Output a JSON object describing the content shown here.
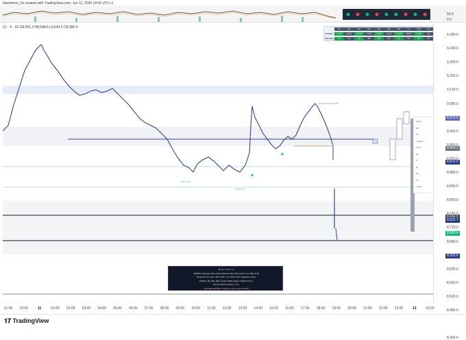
{
  "credit_text": "Nardmirch_0x created with TradingView.com, Jun 11, 2026 18:43 UTC+1",
  "symbol_line": "CL · 5 · IG  O8,551.3  H8,588.5  L8,544.5  C8,580.4",
  "right_axis": {
    "ticks": [
      "9,280.0",
      "9,240.0",
      "9,200.0",
      "9,160.0",
      "9,120.0",
      "9,080.0",
      "9,040.0",
      "9,000.0",
      "8,960.0",
      "8,920.0",
      "8,880.0",
      "8,840.0",
      "8,800.0",
      "8,760.0",
      "8,720.0",
      "8,680.0",
      "8,640.0",
      "8,600.0",
      "8,560.0",
      "8,520.0",
      "8,480.0",
      "8,440.0",
      "8,400.0"
    ],
    "tags": [
      {
        "text": "8,975.9",
        "color": "#5b6abf"
      },
      {
        "text": "8,869.2",
        "color": "#6b7280"
      },
      {
        "text": "8,823.9",
        "color": "#1e3a8a"
      },
      {
        "text": "8,642.5",
        "color": "#374151"
      },
      {
        "text": "8,622.7",
        "color": "#1e3a8a"
      },
      {
        "text": "8,580.4",
        "color": "#10b981"
      },
      {
        "text": "8,503.6",
        "color": "#1e3a8a"
      }
    ]
  },
  "indicator_axis": {
    "top_value": "50.0",
    "bottom_value": "0.0"
  },
  "x_axis": {
    "labels": [
      "21:00",
      "23:00",
      "11",
      "01:00",
      "02:00",
      "03:00",
      "04:00",
      "05:00",
      "06:00",
      "07:00",
      "08:00",
      "09:00",
      "10:00",
      "11:00",
      "12:00",
      "13:00",
      "14:00",
      "15:00",
      "16:00",
      "17:00",
      "18:00",
      "19:00",
      "20:00",
      "21:00",
      "22:00",
      "23:00",
      "12",
      "01:00"
    ],
    "bold": [
      "11",
      "12"
    ]
  },
  "top_table": {
    "rows": [
      [
        "",
        "1h",
        "4h",
        "1D",
        "1W",
        "1M",
        "3M",
        "6M",
        "1Y",
        "YTD",
        "Vol"
      ],
      [
        "Change",
        "+1.2%",
        "-0.4%",
        "+2.1%",
        "-1.8%",
        "+3.3%",
        "-5.1%",
        "+1.4%",
        "+8.9%",
        "-2.2%",
        "19"
      ],
      [
        "Summary",
        "26",
        "31",
        "44",
        "38",
        "52",
        "29",
        "47",
        "61",
        "35",
        "22"
      ]
    ]
  },
  "levels_panel": {
    "labels": [
      "Upper",
      "R3",
      "R2",
      "Legend",
      "Level",
      "R1",
      "P",
      "S1",
      "S2",
      "S3",
      "Lower"
    ]
  },
  "markers": {
    "label_a": "8,814 (19)",
    "label_b": "8,799 (22)"
  },
  "info_box": {
    "lines": [
      "◆ Information 14",
      "AIRSPS: Retained New Closes (Price at 8% / 8th-column in a (VA) % 8)",
      "Reserved: 9K | Ave: 300 | POC: 14 | VA%: 70% | Sessions: Daily",
      "KIRSIG: 86 | Bar: 600 | 1.41% 108% Highs | VWAP 8,573 |",
      "8,573 | 8,560 | 8,540 | T: 14 |",
      "18:43 ◆ WARNING: Retained New Closes 44.5%"
    ]
  },
  "footer": {
    "brand": "TradingView"
  },
  "colors": {
    "candle": "#3b3f8f",
    "accent_blue": "#1e3a8a",
    "green": "#10b981",
    "band": "#dbe4f5"
  }
}
